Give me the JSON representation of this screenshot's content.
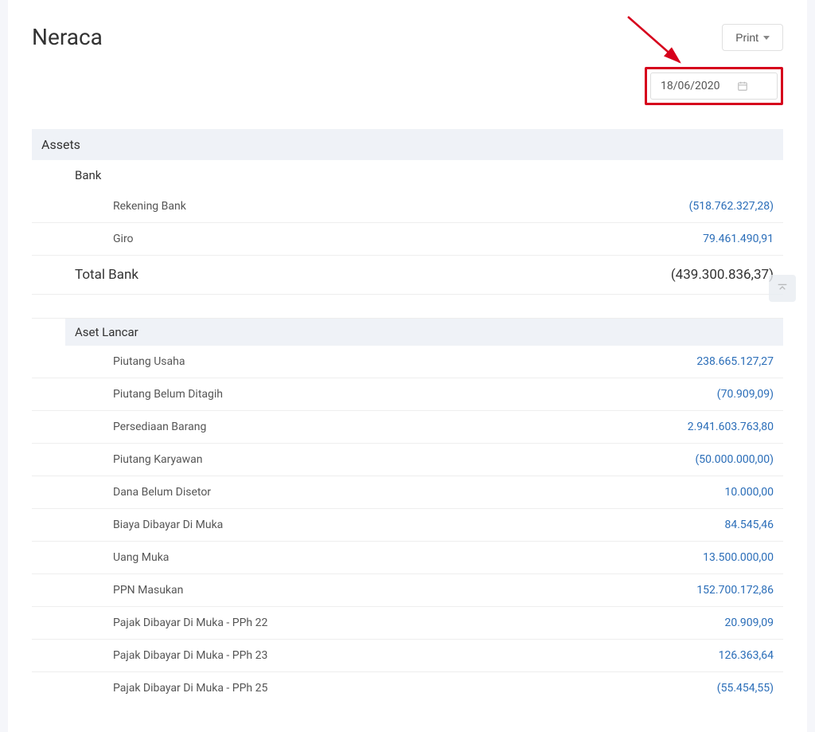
{
  "header": {
    "title": "Neraca",
    "print_label": "Print"
  },
  "date": {
    "value": "18/06/2020"
  },
  "sections": {
    "assets_label": "Assets",
    "bank_label": "Bank",
    "bank_rows": [
      {
        "label": "Rekening Bank",
        "value": "(518.762.327,28)"
      },
      {
        "label": "Giro",
        "value": "79.461.490,91"
      }
    ],
    "total_bank_label": "Total Bank",
    "total_bank_value": "(439.300.836,37)",
    "aset_lancar_label": "Aset Lancar",
    "aset_lancar_rows": [
      {
        "label": "Piutang Usaha",
        "value": "238.665.127,27"
      },
      {
        "label": "Piutang Belum Ditagih",
        "value": "(70.909,09)"
      },
      {
        "label": "Persediaan Barang",
        "value": "2.941.603.763,80"
      },
      {
        "label": "Piutang Karyawan",
        "value": "(50.000.000,00)"
      },
      {
        "label": "Dana Belum Disetor",
        "value": "10.000,00"
      },
      {
        "label": "Biaya Dibayar Di Muka",
        "value": "84.545,46"
      },
      {
        "label": "Uang Muka",
        "value": "13.500.000,00"
      },
      {
        "label": "PPN Masukan",
        "value": "152.700.172,86"
      },
      {
        "label": "Pajak Dibayar Di Muka - PPh 22",
        "value": "20.909,09"
      },
      {
        "label": "Pajak Dibayar Di Muka - PPh 23",
        "value": "126.363,64"
      },
      {
        "label": "Pajak Dibayar Di Muka - PPh 25",
        "value": "(55.454,55)"
      }
    ]
  }
}
